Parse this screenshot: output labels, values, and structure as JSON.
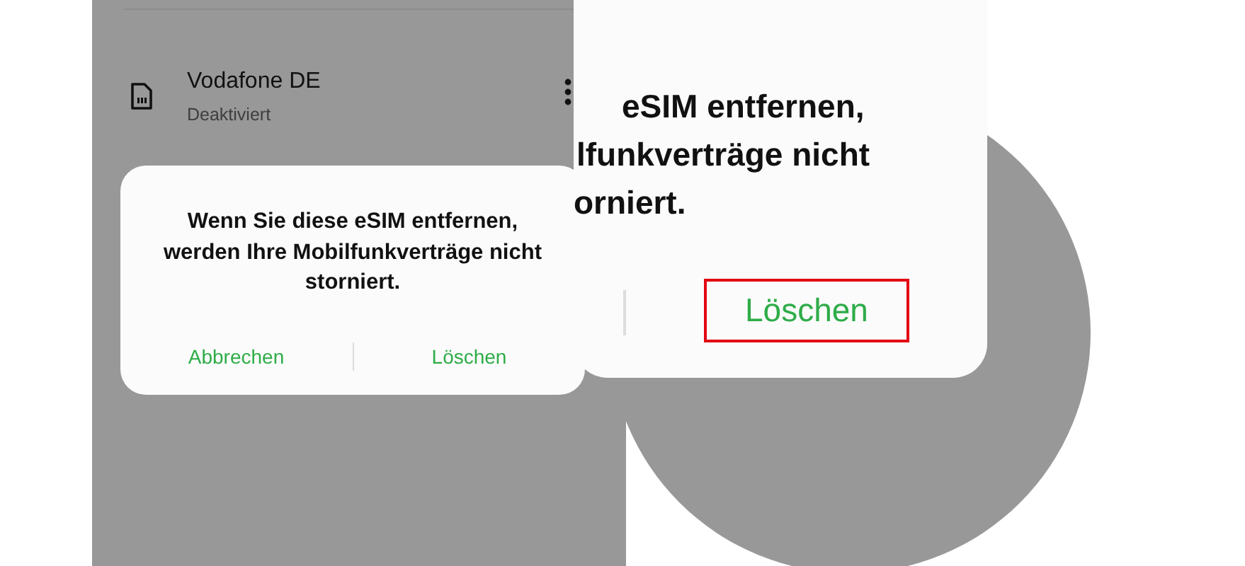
{
  "sim_list": {
    "items": [
      {
        "name": "Vodafone DE",
        "status": "Deaktiviert"
      }
    ]
  },
  "dialog": {
    "message": "Wenn Sie diese eSIM entfernen, werden Ihre Mobilfunkverträge nicht storniert.",
    "buttons": [
      {
        "label": "Abbrechen"
      },
      {
        "label": "Löschen"
      }
    ]
  },
  "magnified_dialog": {
    "message_lines": [
      "eSIM entfernen,",
      "lfunkverträge nicht",
      "orniert."
    ],
    "button": {
      "label": "Löschen",
      "highlighted": true
    }
  }
}
